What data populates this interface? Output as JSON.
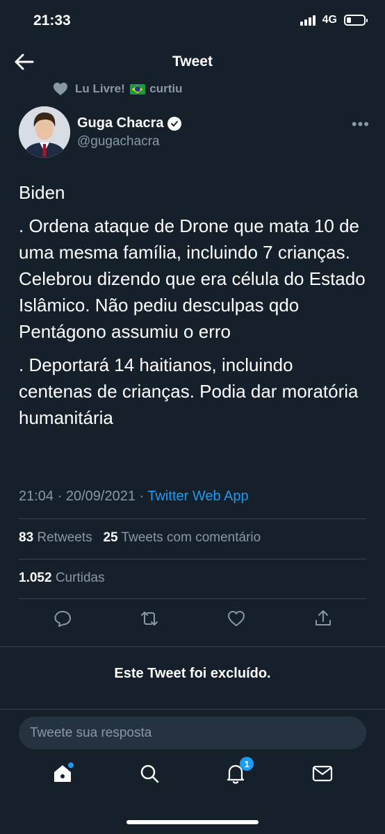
{
  "status": {
    "time": "21:33",
    "network": "4G"
  },
  "header": {
    "title": "Tweet"
  },
  "social_context": {
    "name": "Lu Livre!",
    "action": "curtiu"
  },
  "author": {
    "name": "Guga Chacra",
    "handle": "@gugachacra"
  },
  "tweet": {
    "paragraphs": [
      "Biden",
      ". Ordena ataque de Drone que mata 10 de uma mesma família, incluindo 7 crianças. Celebrou dizendo que era célula do Estado Islâmico. Não pediu desculpas qdo Pentágono assumiu o erro",
      ". Deportará 14 haitianos, incluindo centenas de crianças. Podia dar moratória humanitária"
    ],
    "time": "21:04",
    "date": "20/09/2021",
    "source": "Twitter Web App"
  },
  "stats": {
    "retweets_count": "83",
    "retweets_label": "Retweets",
    "quotes_count": "25",
    "quotes_label": "Tweets com comentário",
    "likes_count": "1.052",
    "likes_label": "Curtidas"
  },
  "deleted_notice": "Este Tweet foi excluído.",
  "reply": {
    "placeholder": "Tweete sua resposta"
  },
  "nav": {
    "notifications_badge": "1"
  },
  "colors": {
    "background": "#15202b",
    "accent": "#1d9bf0",
    "muted": "#8899a6"
  }
}
